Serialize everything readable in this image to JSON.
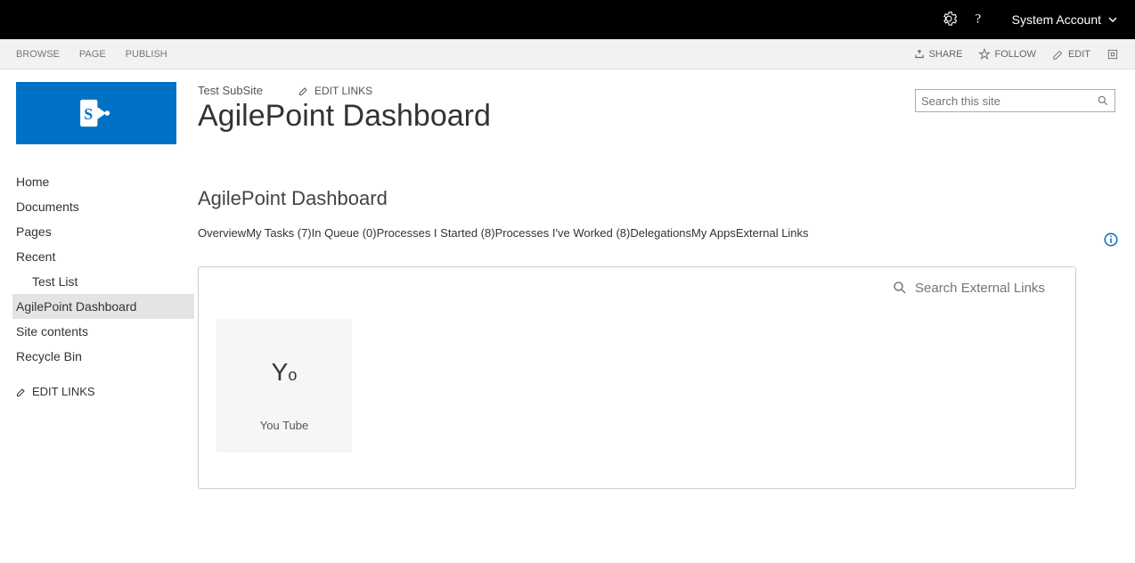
{
  "suite_bar": {
    "user": "System Account"
  },
  "ribbon": {
    "left": [
      "BROWSE",
      "PAGE",
      "PUBLISH"
    ],
    "share": "SHARE",
    "follow": "FOLLOW",
    "edit": "EDIT"
  },
  "breadcrumb": "Test SubSite",
  "edit_links_label": "EDIT LINKS",
  "page_title": "AgilePoint Dashboard",
  "search_placeholder": "Search this site",
  "nav": {
    "items": [
      "Home",
      "Documents",
      "Pages",
      "Recent"
    ],
    "recent_children": [
      "Test List",
      "AgilePoint Dashboard"
    ],
    "bottom": [
      "Site contents",
      "Recycle Bin"
    ],
    "active": "AgilePoint Dashboard"
  },
  "section_title": "AgilePoint Dashboard",
  "tabs": [
    {
      "label": "Overview"
    },
    {
      "label": "My Tasks (7)"
    },
    {
      "label": "In Queue (0)"
    },
    {
      "label": "Processes I Started (8)"
    },
    {
      "label": "Processes I've Worked (8)"
    },
    {
      "label": "Delegations"
    },
    {
      "label": "My Apps"
    },
    {
      "label": "External Links",
      "active": true
    }
  ],
  "panel": {
    "search_placeholder": "Search External Links",
    "tiles": [
      {
        "icon_big": "Y",
        "icon_small": "o",
        "label": "You Tube"
      }
    ]
  }
}
